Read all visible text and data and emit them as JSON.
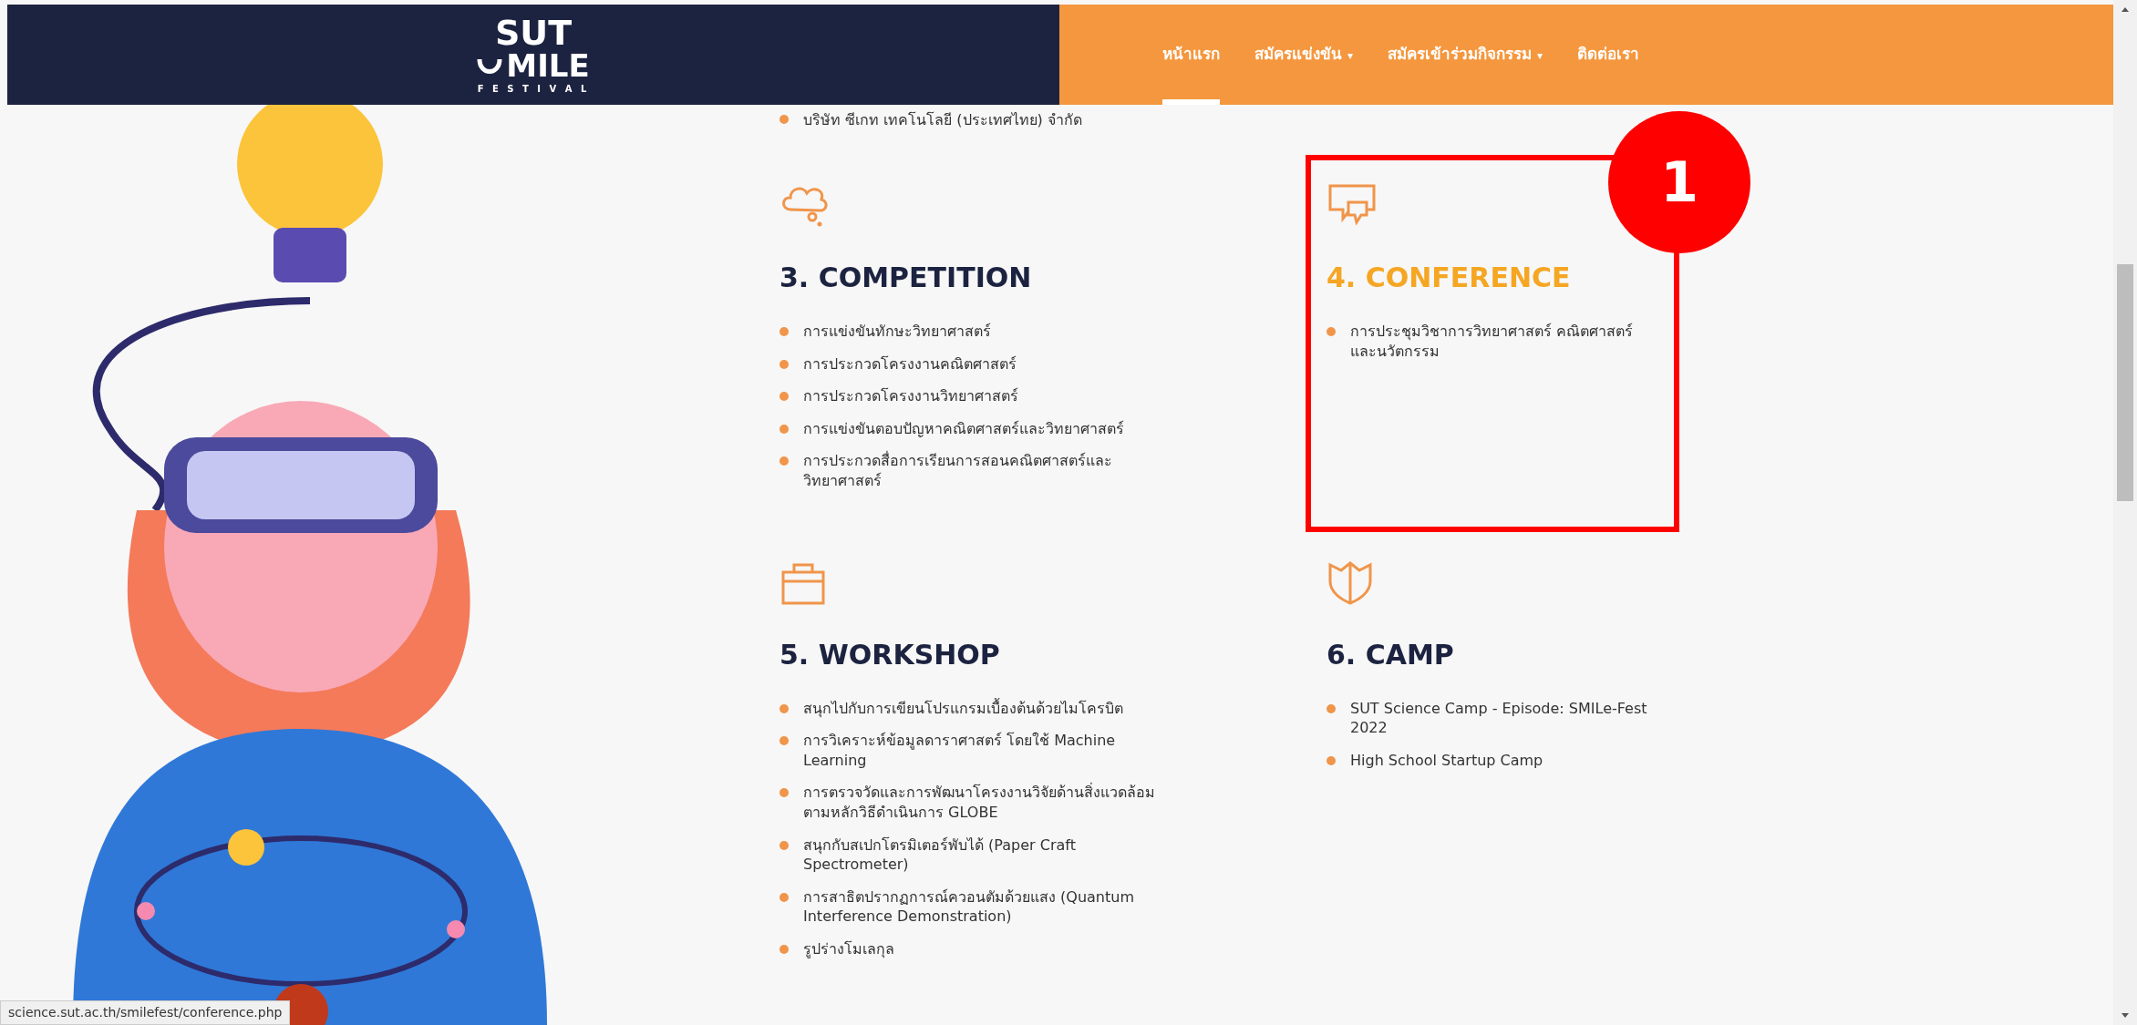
{
  "navbar": {
    "logo": {
      "top": "SUT",
      "middle": "MILE",
      "bottom": "F E S T I V A L"
    },
    "items": [
      {
        "label": "หน้าแรก",
        "selected": true
      },
      {
        "label": "สมัครแข่งขัน",
        "selected": false,
        "caret": "▾"
      },
      {
        "label": "สมัครเข้าร่วมกิจกรรม",
        "selected": false,
        "caret": "▾"
      },
      {
        "label": "ติดต่อเรา",
        "selected": false
      }
    ]
  },
  "previous_item": "บริษัท ซีเกท เทคโนโลยี (ประเทศไทย) จำกัด",
  "sections": [
    {
      "title": "3. COMPETITION",
      "highlighted": false,
      "items": [
        "การแข่งขันทักษะวิทยาศาสตร์",
        "การประกวดโครงงานคณิตศาสตร์",
        "การประกวดโครงงานวิทยาศาสตร์",
        "การแข่งขันตอบปัญหาคณิตศาสตร์และวิทยาศาสตร์",
        "การประกวดสื่อการเรียนการสอนคณิตศาสตร์และวิทยาศาสตร์"
      ]
    },
    {
      "title": "4. CONFERENCE",
      "highlighted": true,
      "items": [
        "การประชุมวิชาการวิทยาศาสตร์ คณิตศาสตร์ และนวัตกรรม"
      ]
    },
    {
      "title": "5. WORKSHOP",
      "highlighted": false,
      "items": [
        "สนุกไปกับการเขียนโปรแกรมเบื้องต้นด้วยไมโครบิต",
        "การวิเคราะห์ข้อมูลดาราศาสตร์ โดยใช้ Machine Learning",
        "การตรวจวัดและการพัฒนาโครงงานวิจัยด้านสิ่งแวดล้อม ตามหลักวิธีดำเนินการ GLOBE",
        "สนุกกับสเปกโตรมิเตอร์พับได้ (Paper Craft Spectrometer)",
        "การสาธิตปรากฏการณ์ควอนตัมด้วยแสง (Quantum Interference Demonstration)",
        "รูปร่างโมเลกุล"
      ]
    },
    {
      "title": "6. CAMP",
      "highlighted": false,
      "items": [
        "SUT Science Camp - Episode: SMILe-Fest 2022",
        "High School Startup Camp"
      ]
    }
  ],
  "annotation": {
    "number": "1"
  },
  "status_bar": {
    "url": "science.sut.ac.th/smilefest/conference.php"
  }
}
